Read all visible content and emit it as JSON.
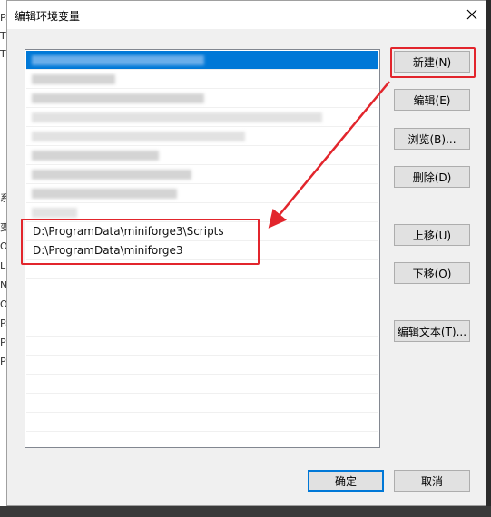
{
  "background_window": {
    "fragments": [
      "Pa",
      "TE",
      "TM",
      "系",
      "变",
      "O",
      "L",
      "N",
      "O",
      "Pa",
      "P",
      "PS"
    ]
  },
  "dialog": {
    "title": "编辑环境变量",
    "close_label": "✕"
  },
  "list": {
    "items": [
      {
        "text": "",
        "selected": true,
        "redacted": true
      },
      {
        "text": "",
        "selected": false,
        "redacted": true
      },
      {
        "text": "",
        "selected": false,
        "redacted": true
      },
      {
        "text": "",
        "selected": false,
        "redacted": true
      },
      {
        "text": "",
        "selected": false,
        "redacted": true
      },
      {
        "text": "",
        "selected": false,
        "redacted": true
      },
      {
        "text": "",
        "selected": false,
        "redacted": true
      },
      {
        "text": "",
        "selected": false,
        "redacted": true
      },
      {
        "text": "",
        "selected": false,
        "redacted": true
      },
      {
        "text": "D:\\ProgramData\\miniforge3\\Scripts",
        "selected": false,
        "redacted": false
      },
      {
        "text": "D:\\ProgramData\\miniforge3",
        "selected": false,
        "redacted": false
      }
    ]
  },
  "buttons": {
    "new": "新建(N)",
    "edit": "编辑(E)",
    "browse": "浏览(B)...",
    "delete": "删除(D)",
    "move_up": "上移(U)",
    "move_down": "下移(O)",
    "edit_text": "编辑文本(T)...",
    "ok": "确定",
    "cancel": "取消"
  },
  "annotation": {
    "color": "#e2252c"
  },
  "colors": {
    "selection": "#0078d7",
    "dialog_bg": "#f0f0f0"
  }
}
